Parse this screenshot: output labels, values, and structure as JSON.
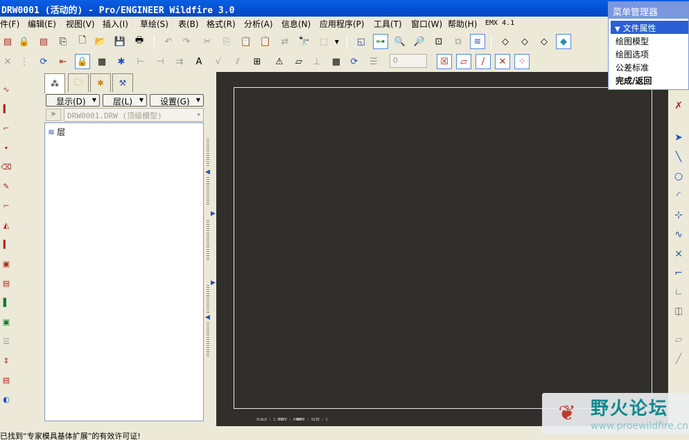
{
  "window": {
    "title": "DRW0001 (活动的) - Pro/ENGINEER Wildfire 3.0"
  },
  "menubar": {
    "items": [
      {
        "label": "件(F)"
      },
      {
        "label": "编辑(E)"
      },
      {
        "label": "视图(V)"
      },
      {
        "label": "插入(I)"
      },
      {
        "label": "草绘(S)"
      },
      {
        "label": "表(B)"
      },
      {
        "label": "格式(R)"
      },
      {
        "label": "分析(A)"
      },
      {
        "label": "信息(N)"
      },
      {
        "label": "应用程序(P)"
      },
      {
        "label": "工具(T)"
      },
      {
        "label": "窗口(W)"
      },
      {
        "label": "帮助(H)"
      },
      {
        "label": "EMX 4.1"
      }
    ]
  },
  "toolbar": {
    "spin_value": "0"
  },
  "navigator": {
    "tabs": [
      "model-tree-icon",
      "folder-icon",
      "favorites-icon",
      "connections-icon"
    ],
    "show_label": "显示(D)",
    "layer_label": "层(L)",
    "settings_label": "设置(G)",
    "model_combo": "DRW0001.DRW (顶级模型)",
    "tree_root_label": "层"
  },
  "canvas": {
    "background": "#312f2c",
    "corner_text_1": "SCALE : 1.000",
    "corner_text_2": "TYPE : PART",
    "corner_text_3": "NAME : SIZE : C"
  },
  "menu_manager": {
    "title": "菜单管理器",
    "selected": "文件属性",
    "items": [
      {
        "label": "绘图模型"
      },
      {
        "label": "绘图选项"
      },
      {
        "label": "公差标准"
      },
      {
        "label": "完成/返回"
      }
    ]
  },
  "statusbar": {
    "message": "已找到“专家模具基体扩展”的有效许可证!"
  },
  "watermark": {
    "text": "野火论坛",
    "url": "www.proewildfire.cn"
  },
  "colors": {
    "titlebar": "#0553d8",
    "menu_selected": "#2b5fd6",
    "accent_blue": "#1a4ec4"
  }
}
